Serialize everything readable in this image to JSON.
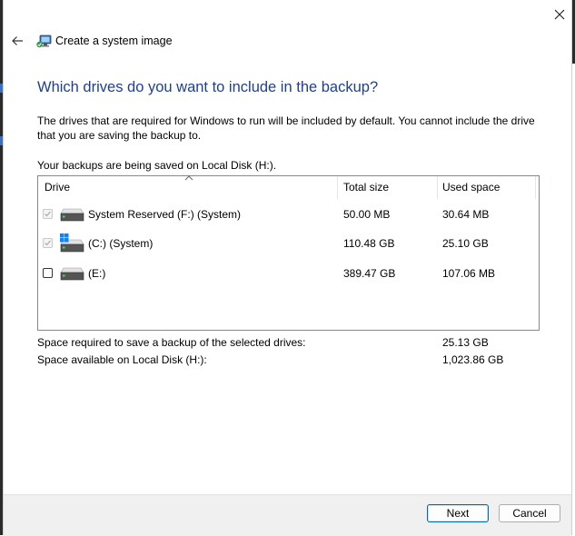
{
  "window": {
    "title": "Create a system image"
  },
  "page": {
    "heading": "Which drives do you want to include in the backup?",
    "description": "The drives that are required for Windows to run will be included by default. You cannot include the drive that you are saving the backup to.",
    "saving_to": "Your backups are being saved on Local Disk (H:)."
  },
  "table": {
    "columns": [
      "Drive",
      "Total size",
      "Used space"
    ],
    "rows": [
      {
        "checked": true,
        "disabled": true,
        "icon": "drive-icon",
        "drive": "System Reserved (F:) (System)",
        "total": "50.00 MB",
        "used": "30.64 MB"
      },
      {
        "checked": true,
        "disabled": true,
        "icon": "windows-drive-icon",
        "drive": "(C:) (System)",
        "total": "110.48 GB",
        "used": "25.10 GB"
      },
      {
        "checked": false,
        "disabled": false,
        "icon": "drive-icon",
        "drive": "(E:)",
        "total": "389.47 GB",
        "used": "107.06 MB"
      }
    ]
  },
  "summary": {
    "required_label": "Space required to save a backup of the selected drives:",
    "required_value": "25.13 GB",
    "available_label": "Space available on Local Disk (H:):",
    "available_value": "1,023.86 GB"
  },
  "buttons": {
    "next": "Next",
    "cancel": "Cancel"
  },
  "colors": {
    "heading": "#1e3f92",
    "accent": "#0067c0"
  }
}
